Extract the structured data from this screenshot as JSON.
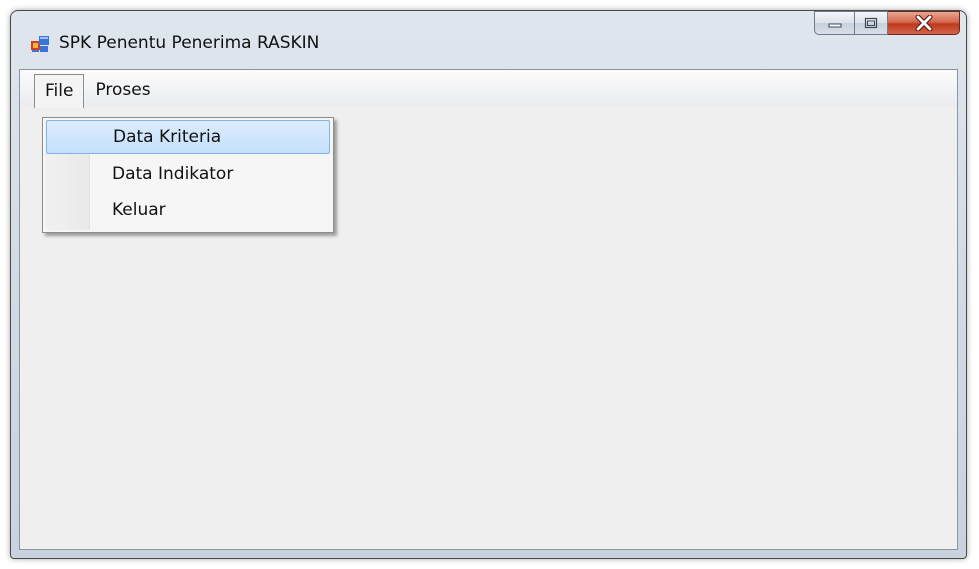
{
  "window": {
    "title": "SPK Penentu Penerima RASKIN",
    "icon": "app-window-icon"
  },
  "caption_buttons": {
    "minimize": "minimize-icon",
    "maximize": "maximize-icon",
    "close": "close-icon"
  },
  "menubar": {
    "items": [
      {
        "label": "File",
        "open": true
      },
      {
        "label": "Proses",
        "open": false
      }
    ]
  },
  "dropdown": {
    "items": [
      {
        "label": "Data Kriteria",
        "highlighted": true
      },
      {
        "label": "Data Indikator",
        "highlighted": false
      },
      {
        "label": "Keluar",
        "highlighted": false
      }
    ]
  },
  "colors": {
    "highlight": "#c5e0fb",
    "highlight_border": "#7fb5e8",
    "close_button": "#c0391c"
  }
}
